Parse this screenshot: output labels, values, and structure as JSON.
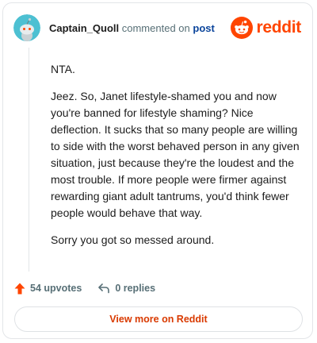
{
  "header": {
    "author": "Captain_Quoll",
    "action_text": "commented on",
    "post_link": "post",
    "brand": "reddit"
  },
  "comment": {
    "paragraphs": [
      "NTA.",
      "Jeez. So, Janet lifestyle-shamed you and now you're banned for lifestyle shaming? Nice deflection. It sucks that so many people are willing to side with the worst behaved person in any given situation, just because they're the loudest and the most trouble. If more people were firmer against rewarding giant adult tantrums, you'd think fewer people would behave that way.",
      "Sorry you got so messed around."
    ]
  },
  "actions": {
    "upvotes": "54 upvotes",
    "replies": "0 replies"
  },
  "footer": {
    "view_more": "View more on Reddit"
  },
  "colors": {
    "brand_orange": "#ff4500",
    "link_blue": "#0a449b",
    "avatar_bg": "#4dc0d2",
    "muted_text": "#576f76"
  },
  "icons": {
    "avatar": "snoo-avatar",
    "brand": "reddit-logo-icon",
    "upvote": "upvote-arrow-icon",
    "reply": "reply-arrow-icon"
  }
}
